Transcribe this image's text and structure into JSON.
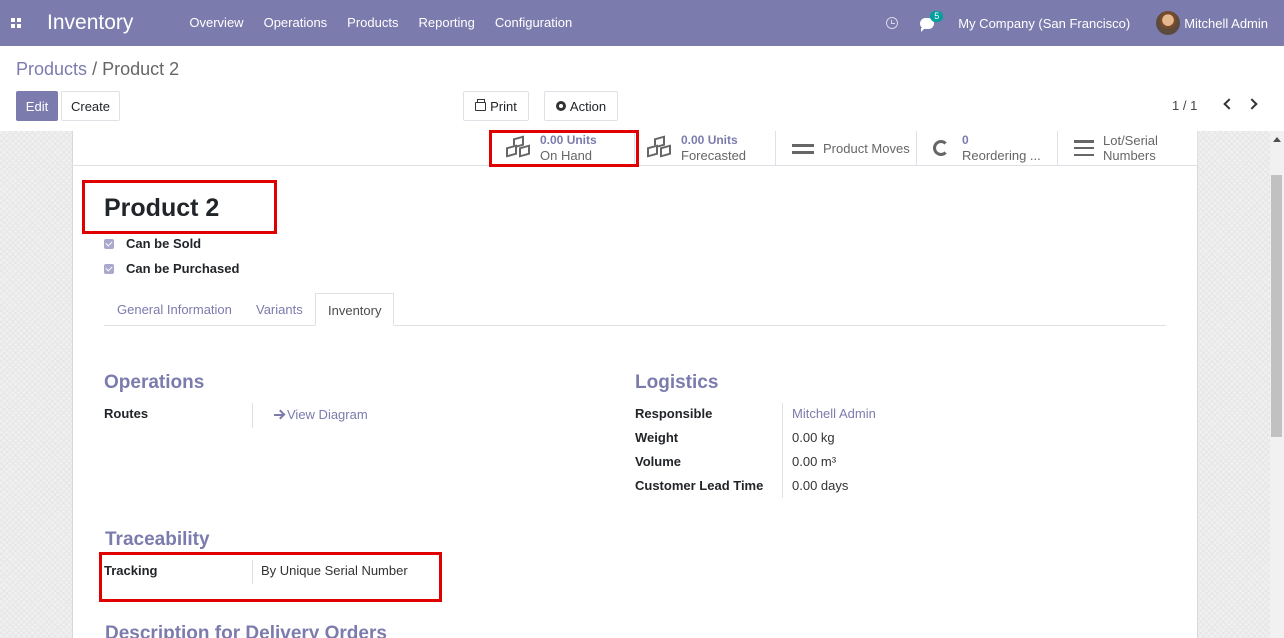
{
  "navbar": {
    "app_name": "Inventory",
    "menu": [
      "Overview",
      "Operations",
      "Products",
      "Reporting",
      "Configuration"
    ],
    "message_count": "5",
    "company": "My Company (San Francisco)",
    "user": "Mitchell Admin"
  },
  "breadcrumb": {
    "parent": "Products",
    "separator": "/",
    "current": "Product 2"
  },
  "toolbar": {
    "edit": "Edit",
    "create": "Create",
    "print": "Print",
    "action": "Action",
    "pager": "1 / 1"
  },
  "stat_buttons": {
    "on_hand": {
      "value": "0.00 Units",
      "label": "On Hand"
    },
    "forecasted": {
      "value": "0.00 Units",
      "label": "Forecasted"
    },
    "product_moves": {
      "label": "Product Moves"
    },
    "reordering": {
      "value": "0",
      "label": "Reordering ..."
    },
    "lot_serial": {
      "line1": "Lot/Serial",
      "line2": "Numbers"
    }
  },
  "product": {
    "name": "Product 2",
    "can_be_sold": "Can be Sold",
    "can_be_purchased": "Can be Purchased"
  },
  "tabs": [
    "General Information",
    "Variants",
    "Inventory"
  ],
  "active_tab": "Inventory",
  "operations": {
    "title": "Operations",
    "routes_label": "Routes",
    "view_diagram": "View Diagram"
  },
  "logistics": {
    "title": "Logistics",
    "responsible_label": "Responsible",
    "responsible_value": "Mitchell Admin",
    "weight_label": "Weight",
    "weight_value": "0.00 kg",
    "volume_label": "Volume",
    "volume_value": "0.00 m³",
    "lead_time_label": "Customer Lead Time",
    "lead_time_value": "0.00 days"
  },
  "traceability": {
    "title": "Traceability",
    "tracking_label": "Tracking",
    "tracking_value": "By Unique Serial Number"
  },
  "description_delivery": {
    "title": "Description for Delivery Orders"
  },
  "colors": {
    "brand": "#7c7bad",
    "highlight": "#e00000"
  }
}
